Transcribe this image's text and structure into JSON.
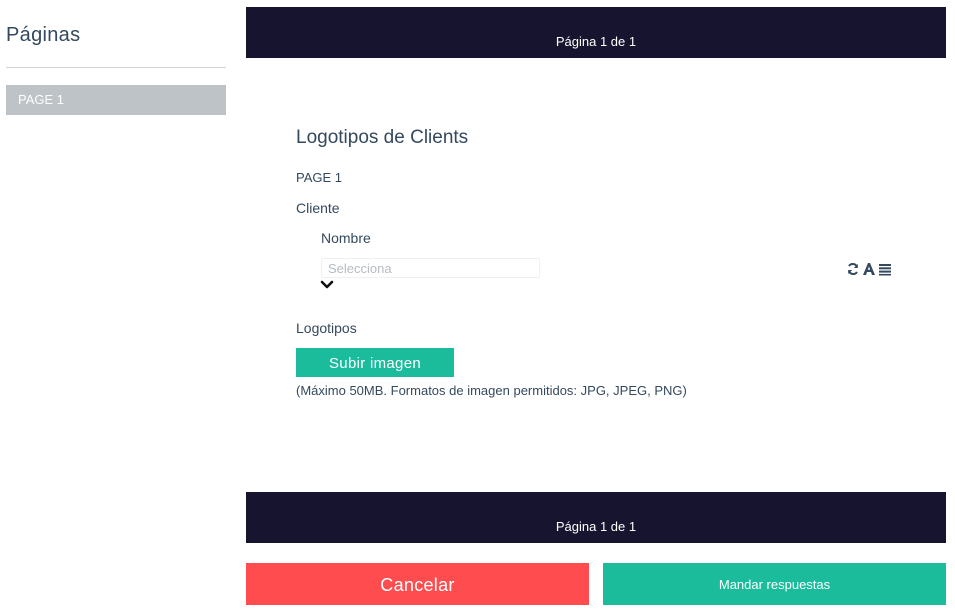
{
  "sidebar": {
    "title": "Páginas",
    "items": [
      {
        "label": "PAGE 1"
      }
    ]
  },
  "banner": {
    "top_text": "Página 1 de 1",
    "bottom_text": "Página 1 de 1"
  },
  "form": {
    "title": "Logotipos de Clients",
    "page_label": "PAGE 1",
    "section_cliente": "Cliente",
    "field_nombre": {
      "label": "Nombre",
      "placeholder": "Selecciona"
    },
    "tool_icons": [
      "refresh-icon",
      "font-icon",
      "list-icon"
    ],
    "section_logotipos": "Logotipos",
    "upload_label": "Subir imagen",
    "upload_hint": "(Máximo 50MB. Formatos de imagen permitidos: JPG, JPEG, PNG)"
  },
  "actions": {
    "cancel_label": "Cancelar",
    "submit_label": "Mandar respuestas"
  },
  "colors": {
    "banner": "#16142e",
    "accent": "#1abc9c",
    "danger": "#ff4d4f",
    "sidebar_item": "#bdc3c7",
    "text": "#34495e"
  }
}
